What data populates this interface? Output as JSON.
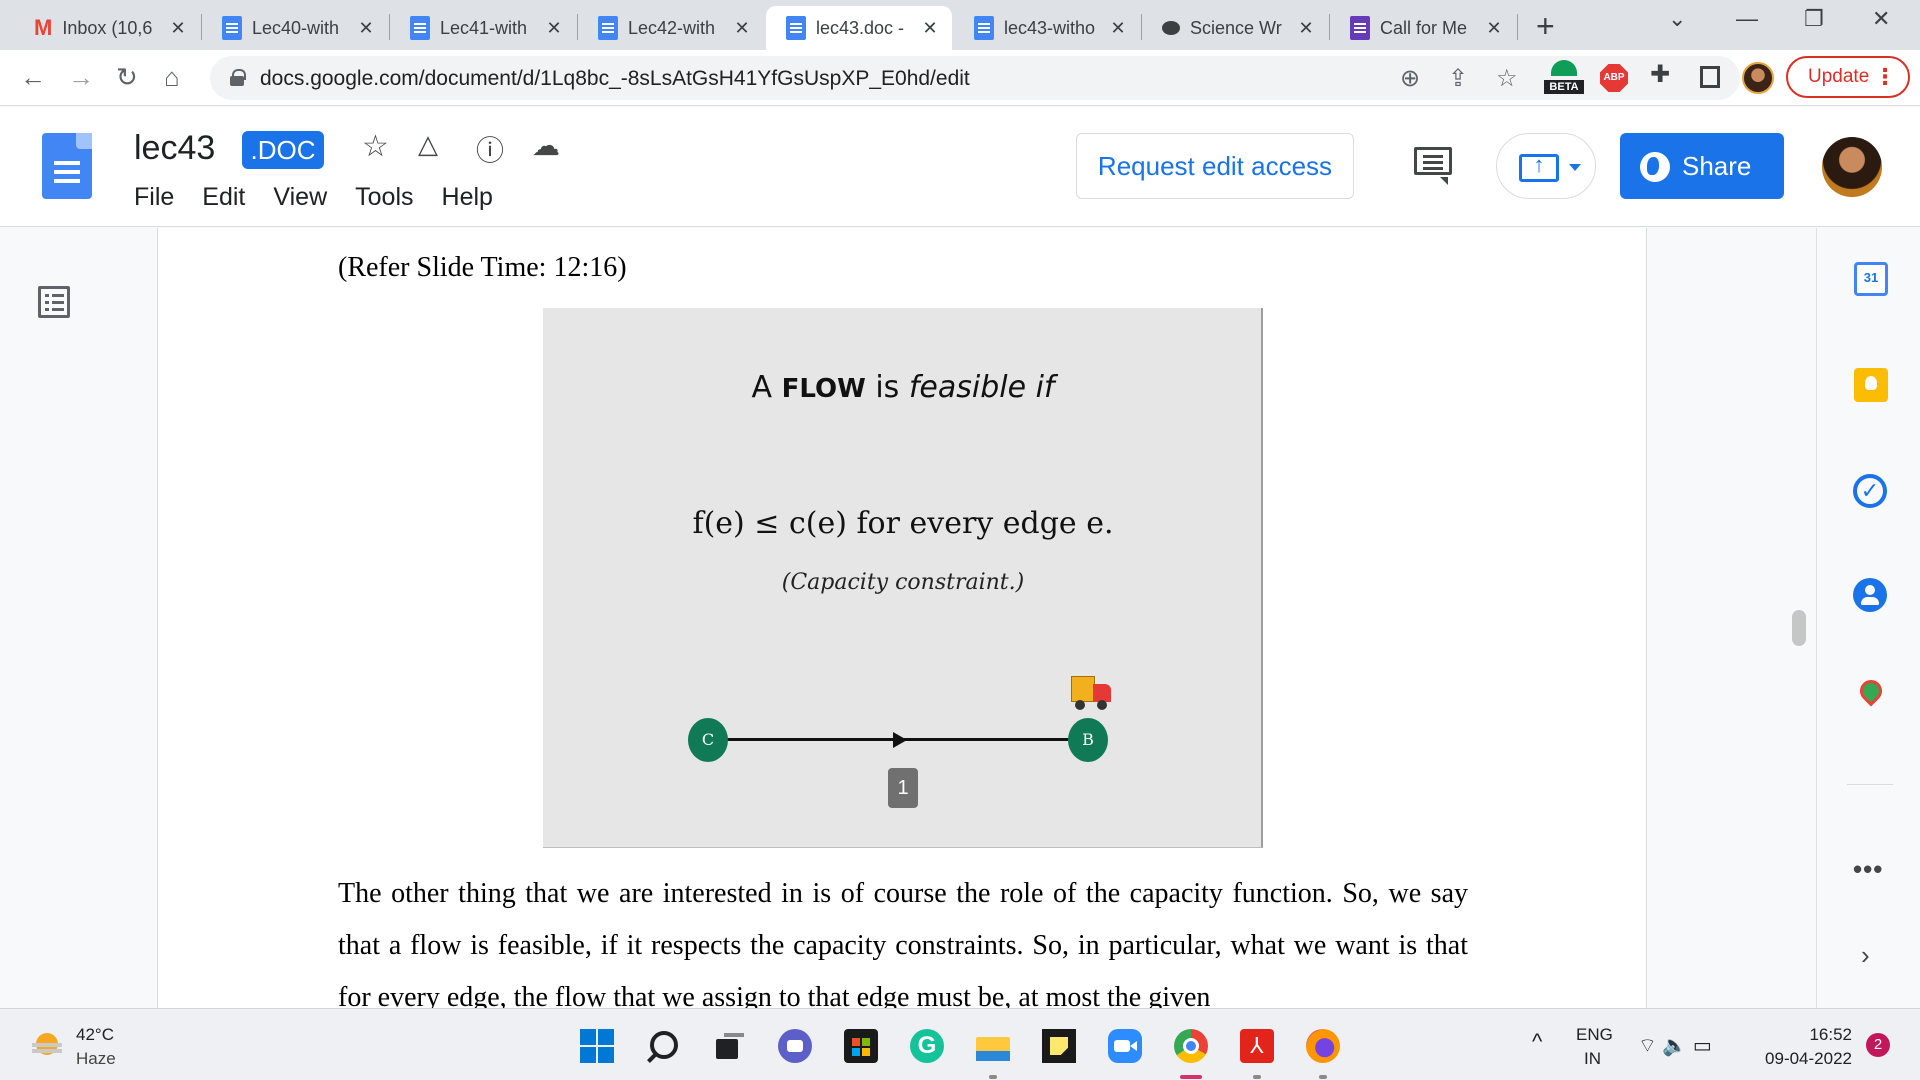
{
  "browser": {
    "tabs": [
      {
        "title": "Inbox (10,6",
        "icon": "gmail-icon"
      },
      {
        "title": "Lec40-with",
        "icon": "docs-icon"
      },
      {
        "title": "Lec41-with",
        "icon": "docs-icon"
      },
      {
        "title": "Lec42-with",
        "icon": "docs-icon"
      },
      {
        "title": "lec43.doc -",
        "icon": "docs-icon",
        "active": true
      },
      {
        "title": "lec43-witho",
        "icon": "docs-icon"
      },
      {
        "title": "Science Wr",
        "icon": "chat-bubble-icon"
      },
      {
        "title": "Call for Me",
        "icon": "forms-icon"
      }
    ],
    "url": "docs.google.com/document/d/1Lq8bc_-8sLsAtGsH41YfGsUspXP_E0hd/edit",
    "extension_beta_label": "BETA",
    "extension_abp_label": "ABP",
    "update_label": "Update"
  },
  "docs": {
    "title": "lec43",
    "file_badge": ".DOC",
    "menu": [
      "File",
      "Edit",
      "View",
      "Tools",
      "Help"
    ],
    "request_edit_label": "Request edit access",
    "share_label": "Share",
    "accent_color": "#1a73e8"
  },
  "document": {
    "refer_text": "(Refer Slide Time: 12:16)",
    "slide": {
      "title_prefix": "A",
      "title_strong": "FLOW",
      "title_mid": "is",
      "title_italic": "feasible if",
      "formula": "f(e) ≤ c(e) for every edge e.",
      "note": "(Capacity constraint.)",
      "node_left": "C",
      "node_right": "B",
      "edge_capacity": "1"
    },
    "paragraph": "The other thing that we are interested in is of course the role of the capacity function. So, we say that a flow is feasible, if it respects the capacity constraints. So, in particular, what we want is that for every edge, the flow that we assign to that edge must be, at most the given"
  },
  "side_panel": {
    "calendar_day": "31"
  },
  "taskbar": {
    "temperature": "42°C",
    "weather": "Haze",
    "grammarly_letter": "G",
    "lang_line1": "ENG",
    "lang_line2": "IN",
    "time": "16:52",
    "date": "09-04-2022",
    "notifications": "2"
  }
}
